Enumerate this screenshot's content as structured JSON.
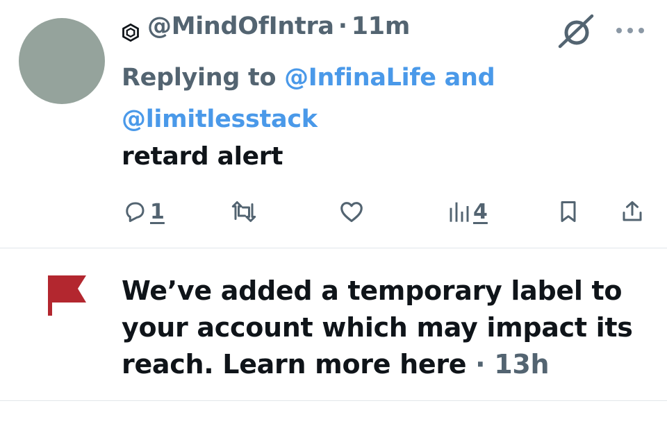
{
  "tweet": {
    "handle": "@MindOfIntra",
    "separator": "·",
    "time": "11m",
    "replying_prefix": "Replying to",
    "reply_to_1": "@InfinaLife",
    "reply_conjunction": "and",
    "reply_to_2": "@limitlesstack",
    "text": "retard alert",
    "reply_count": "1",
    "view_count": "4"
  },
  "icons": {
    "badge": "hexagon-badge-icon",
    "no_entry": "no-entry-icon",
    "more": "more-icon",
    "reply": "reply-icon",
    "retweet": "retweet-icon",
    "like": "heart-icon",
    "views": "views-icon",
    "bookmark": "bookmark-icon",
    "share": "share-icon",
    "flag": "flag-icon"
  },
  "notice": {
    "text": "We’ve added a temporary label to your account which may impact its reach. Learn more here",
    "separator": "·",
    "time": "13h"
  },
  "colors": {
    "link": "#4a99e9",
    "secondary_text": "#536471",
    "primary_text": "#0f1419",
    "flag": "#b3272f",
    "avatar": "#95a39c"
  }
}
